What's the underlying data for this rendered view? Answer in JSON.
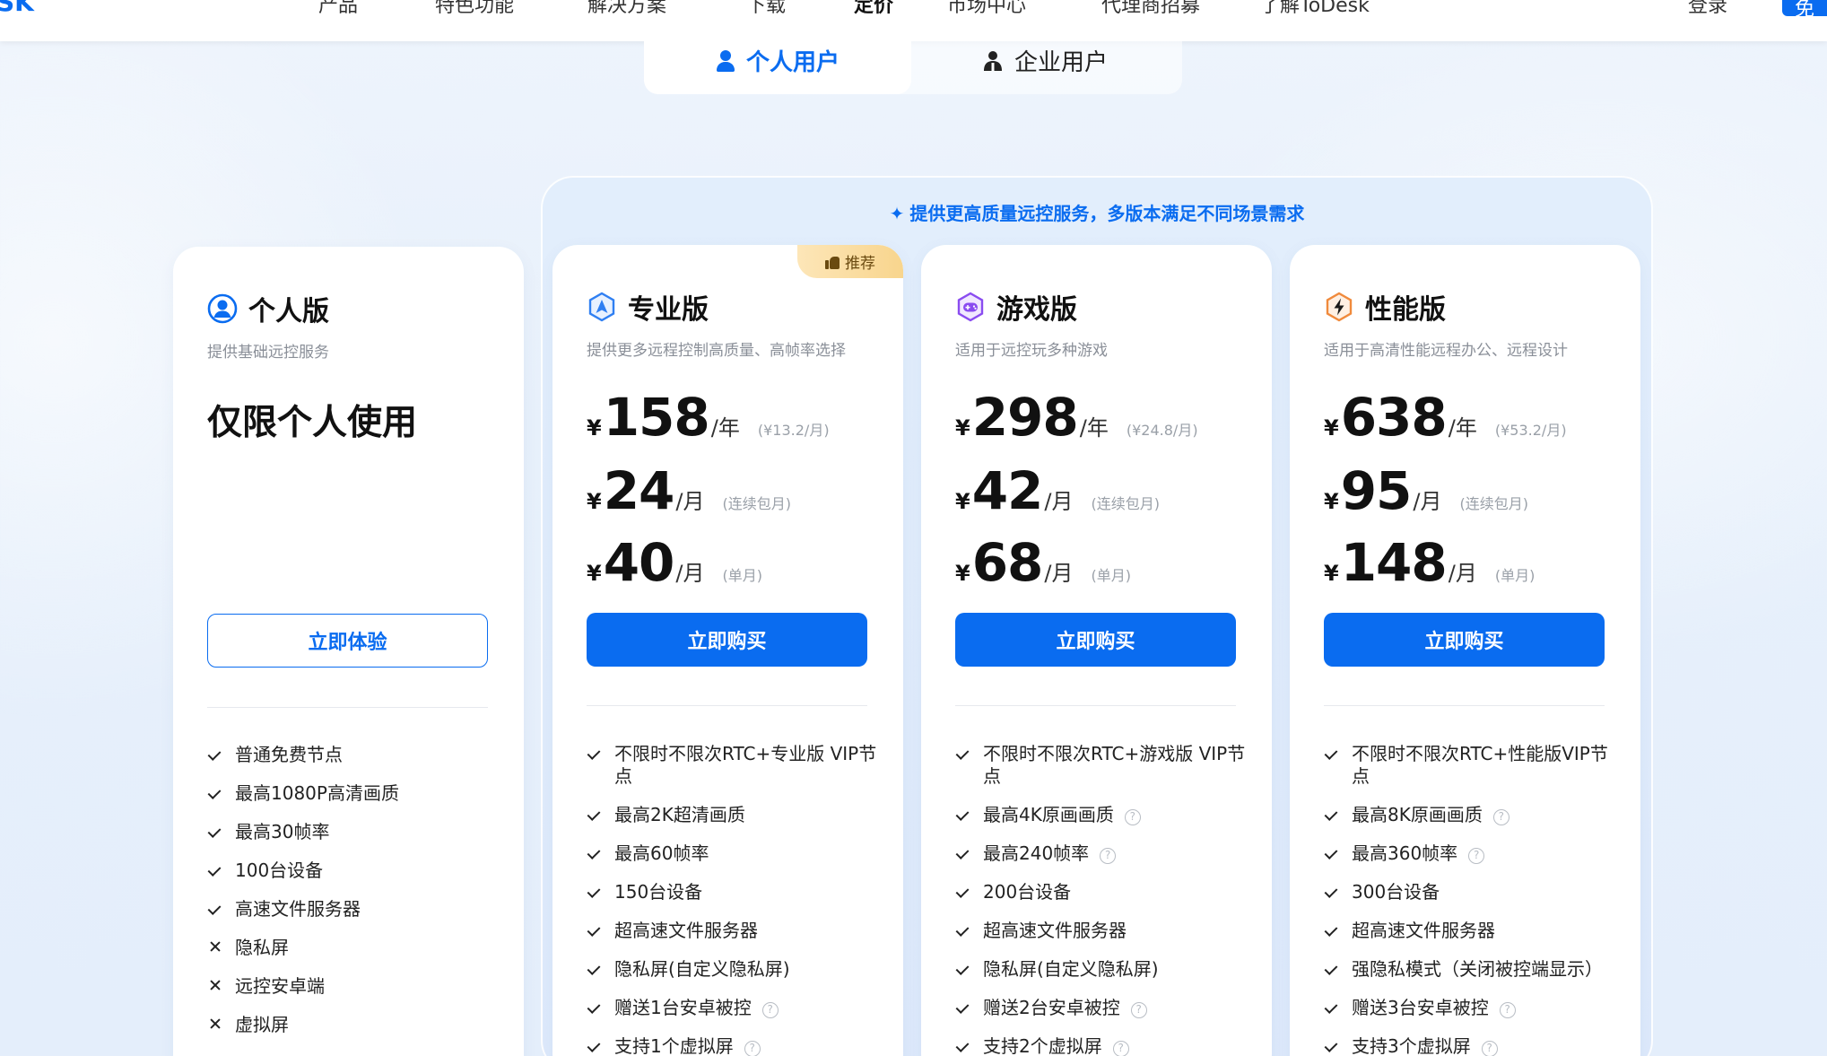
{
  "nav": {
    "logo": "SK",
    "items": [
      "产品",
      "特色功能",
      "解决方案",
      "下载",
      "定价",
      "市场中心",
      "代理商招募",
      "了解ToDesk"
    ],
    "login": "登录",
    "cta": "免"
  },
  "tabs": [
    {
      "label": "个人用户",
      "icon": "user-icon",
      "active": true
    },
    {
      "label": "企业用户",
      "icon": "team-icon",
      "active": false
    }
  ],
  "group_banner": "提供更高质量远控服务，多版本满足不同场景需求",
  "colors": {
    "accent": "#0a6cf0",
    "badge": "#f8d58d"
  },
  "plans": [
    {
      "name": "个人版",
      "desc": "提供基础远控服务",
      "headline": "仅限个人使用",
      "button": "立即体验",
      "icon": "user-circle-icon",
      "features": [
        {
          "text": "普通免费节点",
          "ok": true
        },
        {
          "text": "最高1080P高清画质",
          "ok": true
        },
        {
          "text": "最高30帧率",
          "ok": true
        },
        {
          "text": "100台设备",
          "ok": true
        },
        {
          "text": "高速文件服务器",
          "ok": true
        },
        {
          "text": "隐私屏",
          "ok": false
        },
        {
          "text": "远控安卓端",
          "ok": false
        },
        {
          "text": "虚拟屏",
          "ok": false
        }
      ]
    },
    {
      "name": "专业版",
      "badge": "推荐",
      "desc": "提供更多远程控制高质量、高帧率选择",
      "currency": "¥",
      "prices": [
        {
          "num": "158",
          "unit": "/年",
          "note": "(¥13.2/月)"
        },
        {
          "num": "24",
          "unit": "/月",
          "note": "(连续包月)"
        },
        {
          "num": "40",
          "unit": "/月",
          "note": "(单月)"
        }
      ],
      "button": "立即购买",
      "icon": "pro-icon",
      "features": [
        {
          "text": "不限时不限次RTC+专业版 VIP节点",
          "ok": true
        },
        {
          "text": "最高2K超清画质",
          "ok": true
        },
        {
          "text": "最高60帧率",
          "ok": true
        },
        {
          "text": "150台设备",
          "ok": true
        },
        {
          "text": "超高速文件服务器",
          "ok": true
        },
        {
          "text": "隐私屏(自定义隐私屏)",
          "ok": true
        },
        {
          "text": "赠送1台安卓被控",
          "ok": true,
          "help": true
        },
        {
          "text": "支持1个虚拟屏",
          "ok": true,
          "help": true
        }
      ]
    },
    {
      "name": "游戏版",
      "desc": "适用于远控玩多种游戏",
      "currency": "¥",
      "prices": [
        {
          "num": "298",
          "unit": "/年",
          "note": "(¥24.8/月)"
        },
        {
          "num": "42",
          "unit": "/月",
          "note": "(连续包月)"
        },
        {
          "num": "68",
          "unit": "/月",
          "note": "(单月)"
        }
      ],
      "button": "立即购买",
      "icon": "gamepad-icon",
      "features": [
        {
          "text": "不限时不限次RTC+游戏版 VIP节点",
          "ok": true
        },
        {
          "text": "最高4K原画画质",
          "ok": true,
          "help": true
        },
        {
          "text": "最高240帧率",
          "ok": true,
          "help": true
        },
        {
          "text": "200台设备",
          "ok": true
        },
        {
          "text": "超高速文件服务器",
          "ok": true
        },
        {
          "text": "隐私屏(自定义隐私屏)",
          "ok": true
        },
        {
          "text": "赠送2台安卓被控",
          "ok": true,
          "help": true
        },
        {
          "text": "支持2个虚拟屏",
          "ok": true,
          "help": true
        }
      ]
    },
    {
      "name": "性能版",
      "desc": "适用于高清性能远程办公、远程设计",
      "currency": "¥",
      "prices": [
        {
          "num": "638",
          "unit": "/年",
          "note": "(¥53.2/月)"
        },
        {
          "num": "95",
          "unit": "/月",
          "note": "(连续包月)"
        },
        {
          "num": "148",
          "unit": "/月",
          "note": "(单月)"
        }
      ],
      "button": "立即购买",
      "icon": "lightning-icon",
      "features": [
        {
          "text": "不限时不限次RTC+性能版VIP节点",
          "ok": true
        },
        {
          "text": "最高8K原画画质",
          "ok": true,
          "help": true
        },
        {
          "text": "最高360帧率",
          "ok": true,
          "help": true
        },
        {
          "text": "300台设备",
          "ok": true
        },
        {
          "text": "超高速文件服务器",
          "ok": true
        },
        {
          "text": "强隐私模式（关闭被控端显示）",
          "ok": true
        },
        {
          "text": "赠送3台安卓被控",
          "ok": true,
          "help": true
        },
        {
          "text": "支持3个虚拟屏",
          "ok": true,
          "help": true
        }
      ]
    }
  ]
}
